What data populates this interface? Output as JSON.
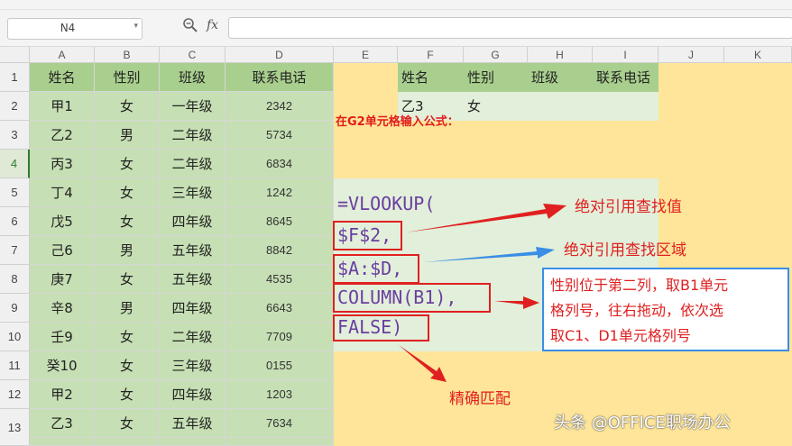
{
  "formula_bar": {
    "name_box": "N4",
    "fx_label": "fx",
    "formula_value": ""
  },
  "columns": [
    "A",
    "B",
    "C",
    "D",
    "E",
    "F",
    "G",
    "H",
    "I",
    "J",
    "K"
  ],
  "rows": [
    "1",
    "2",
    "3",
    "4",
    "5",
    "6",
    "7",
    "8",
    "9",
    "10",
    "11",
    "12",
    "13"
  ],
  "selected_row": "4",
  "table": {
    "headers": [
      "姓名",
      "性别",
      "班级",
      "联系电话"
    ],
    "rows": [
      [
        "甲1",
        "女",
        "一年级",
        "2342"
      ],
      [
        "乙2",
        "男",
        "二年级",
        "5734"
      ],
      [
        "丙3",
        "女",
        "二年级",
        "6834"
      ],
      [
        "丁4",
        "女",
        "三年级",
        "1242"
      ],
      [
        "戊5",
        "女",
        "四年级",
        "8645"
      ],
      [
        "己6",
        "男",
        "五年级",
        "8842"
      ],
      [
        "庚7",
        "女",
        "五年级",
        "4535"
      ],
      [
        "辛8",
        "男",
        "四年级",
        "6643"
      ],
      [
        "壬9",
        "女",
        "二年级",
        "7709"
      ],
      [
        "癸10",
        "女",
        "三年级",
        "0155"
      ],
      [
        "甲2",
        "女",
        "四年级",
        "1203"
      ],
      [
        "乙3",
        "女",
        "五年级",
        "7634"
      ]
    ]
  },
  "lookup": {
    "headers": [
      "姓名",
      "性别",
      "班级",
      "联系电话"
    ],
    "row": [
      "乙3",
      "女",
      "",
      ""
    ]
  },
  "annotation": {
    "instruction": "在G2单元格输入公式：",
    "formula_lines": [
      "=VLOOKUP(",
      "$F$2,",
      "$A:$D,",
      "COLUMN(B1),",
      "FALSE)"
    ],
    "notes": {
      "abs_value": "绝对引用查找值",
      "abs_range": "绝对引用查找区域",
      "column_note": [
        "性别位于第二列，取B1单元",
        "格列号，往右拖动，依次选",
        "取C1、D1单元格列号"
      ],
      "exact": "精确匹配"
    },
    "watermark": "头条 @OFFICE职场办公"
  },
  "colors": {
    "header_green": "#a9cf8e",
    "data_green": "#c6dfb4",
    "peach": "#fee599",
    "red": "#e02020",
    "blue": "#3a8ee6",
    "purple": "#6a3ea1"
  }
}
